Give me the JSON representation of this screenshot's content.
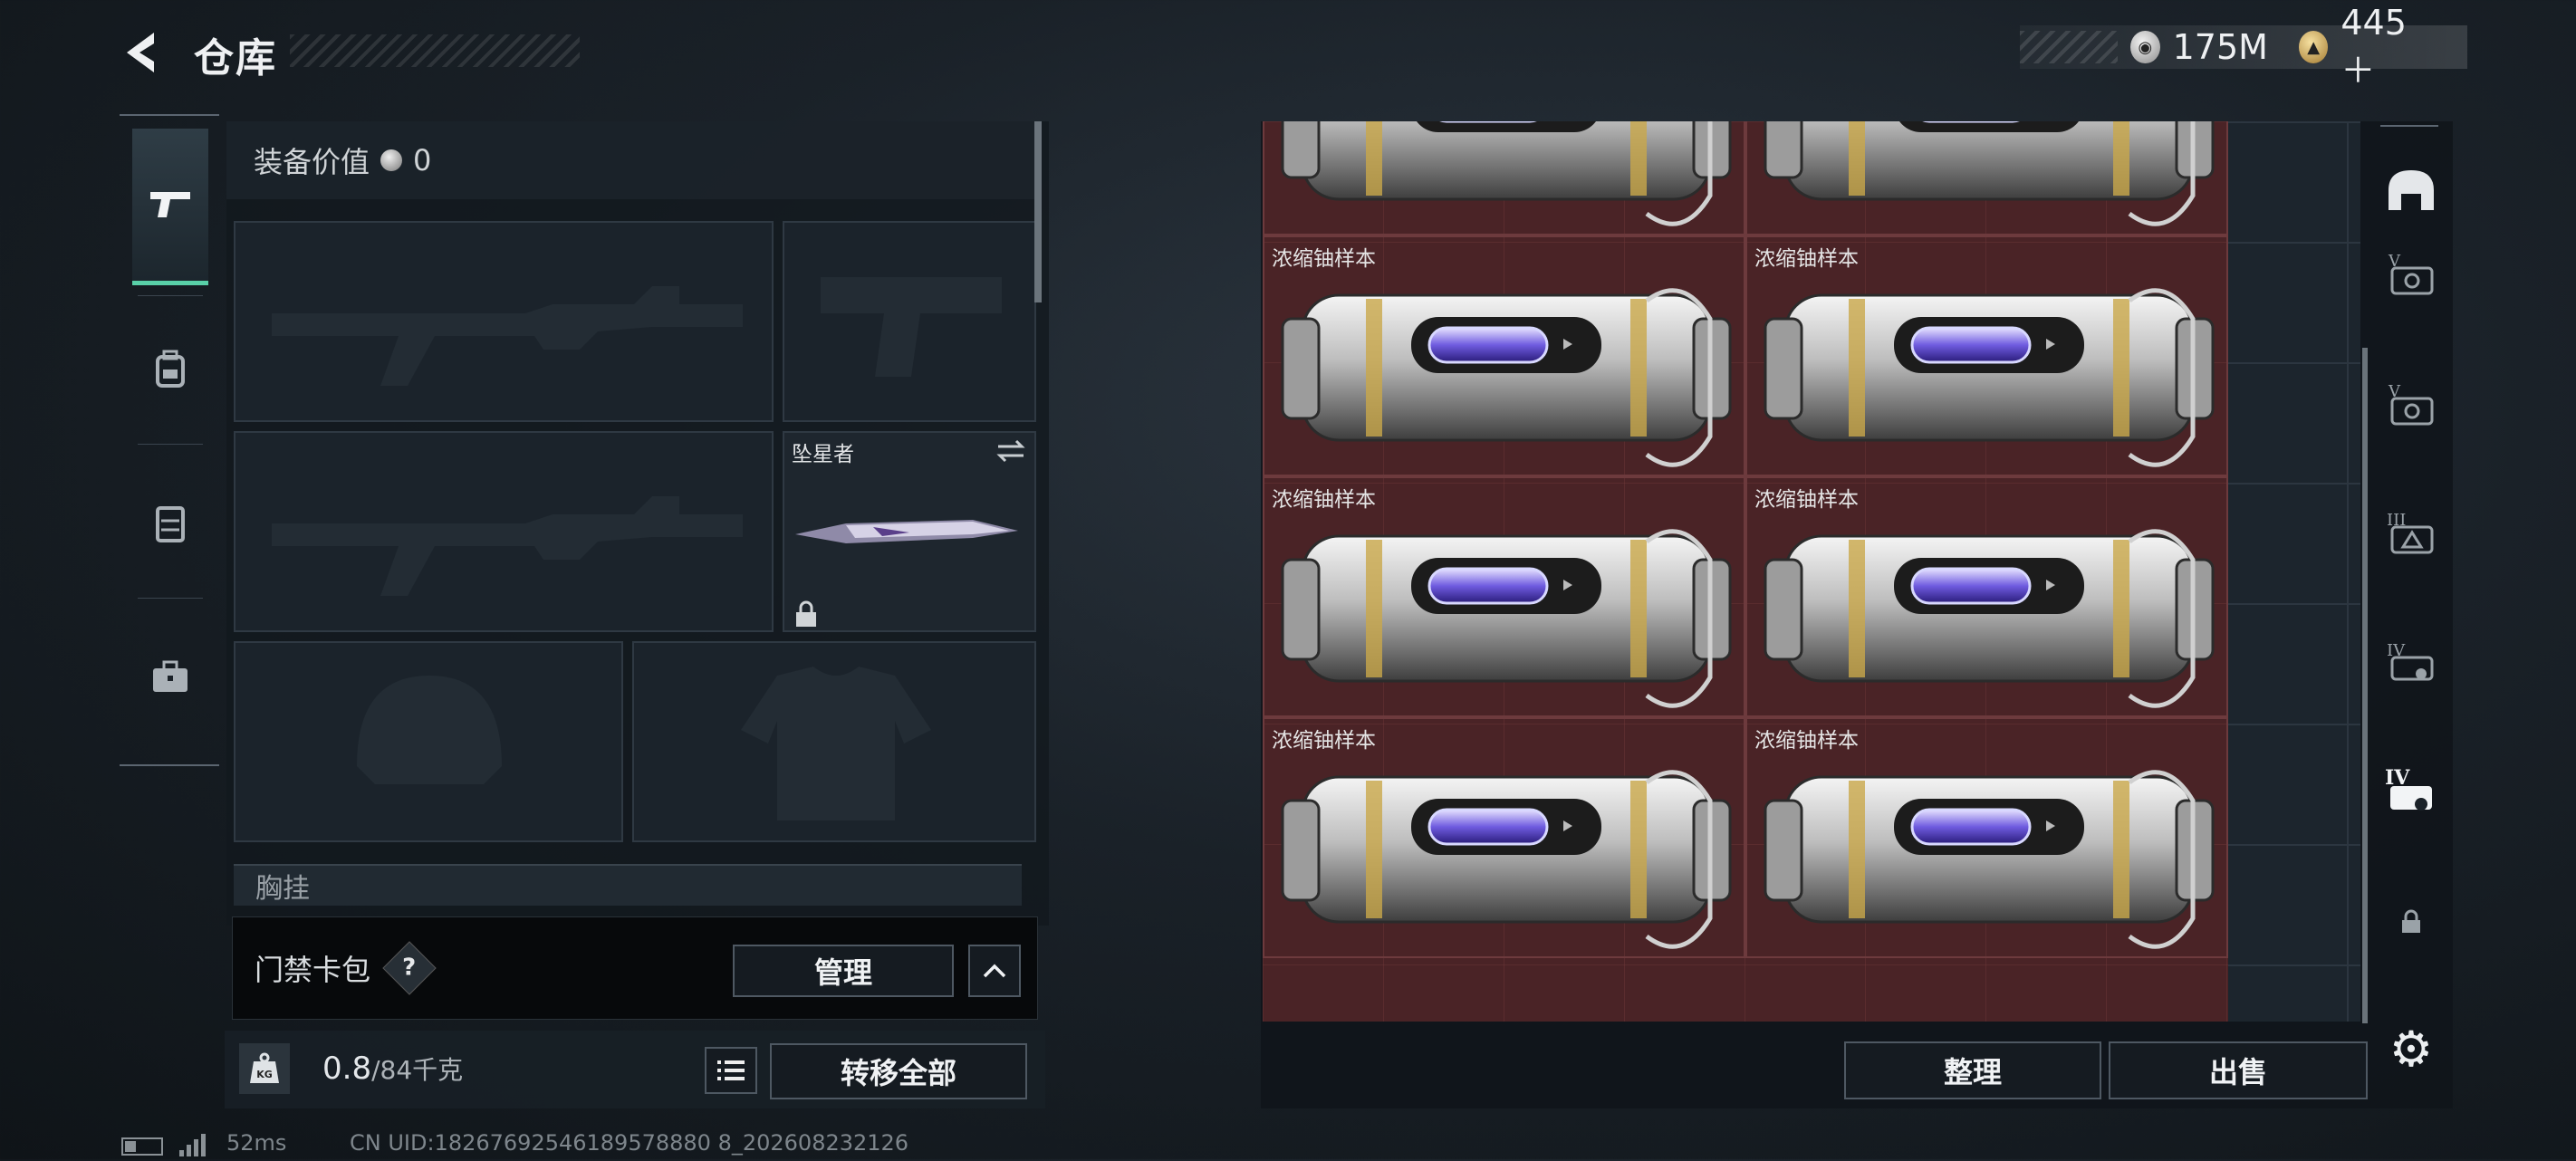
{
  "header": {
    "title": "仓库",
    "currencies": [
      {
        "icon": "silver-coin-icon",
        "value": "175M"
      },
      {
        "icon": "gold-coin-icon",
        "value": "445＋"
      }
    ]
  },
  "equipment": {
    "value_label": "装备价值",
    "value": "0",
    "melee_name": "坠星者",
    "chest_label": "胸挂",
    "card_wallet_label": "门禁卡包",
    "help": "?",
    "manage_button": "管理"
  },
  "weight": {
    "current": "0.8",
    "max": "/84千克",
    "kg_icon_text": "KG"
  },
  "actions": {
    "transfer_all": "转移全部",
    "sort": "整理",
    "sell": "出售"
  },
  "storage": {
    "items": [
      {
        "label": ""
      },
      {
        "label": ""
      },
      {
        "label": "浓缩铀样本"
      },
      {
        "label": "浓缩铀样本"
      },
      {
        "label": "浓缩铀样本"
      },
      {
        "label": "浓缩铀样本"
      },
      {
        "label": "浓缩铀样本"
      },
      {
        "label": "浓缩铀样本"
      }
    ]
  },
  "right_rail": {
    "icons": [
      "helmet-icon",
      "level-v-vest-icon",
      "level-v-rig-icon",
      "level-iii-icon",
      "level-iv-icon",
      "level-iv-active-icon",
      "lock-icon",
      "gear-icon"
    ]
  },
  "footer": {
    "ping": "52ms",
    "uid": "CN UID:18267692546189578880 8_202608232126"
  }
}
